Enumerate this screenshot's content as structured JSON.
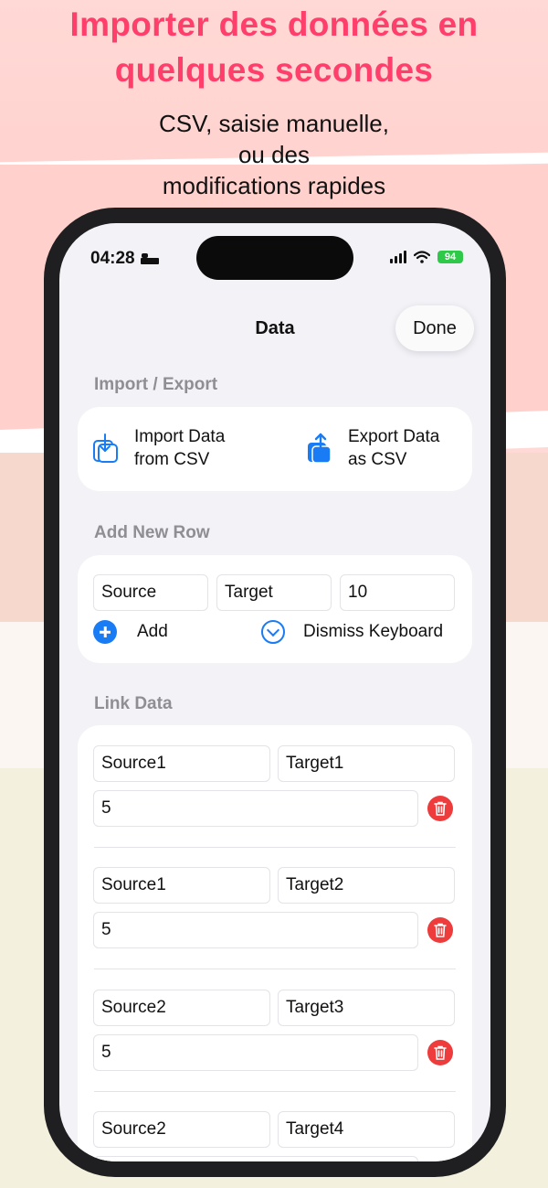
{
  "promo": {
    "headline_line1": "Importer des données en",
    "headline_line2": "quelques secondes",
    "sub_line1": "CSV, saisie manuelle,",
    "sub_line2": "ou des",
    "sub_line3": "modifications rapides"
  },
  "status_bar": {
    "time": "04:28",
    "battery": "94",
    "icons": [
      "bed-icon",
      "cellular-signal-icon",
      "wifi-icon",
      "battery-charging-icon"
    ]
  },
  "nav": {
    "title": "Data",
    "done_label": "Done"
  },
  "import_export": {
    "section_label": "Import / Export",
    "import_line1": "Import Data",
    "import_line2": "from CSV",
    "export_line1": "Export Data",
    "export_line2": "as CSV"
  },
  "add_row": {
    "section_label": "Add New Row",
    "source_value": "Source",
    "target_value": "Target",
    "value_value": "10",
    "add_label": "Add",
    "dismiss_label": "Dismiss Keyboard"
  },
  "link_data": {
    "section_label": "Link Data",
    "rows": [
      {
        "source": "Source1",
        "target": "Target1",
        "value": "5"
      },
      {
        "source": "Source1",
        "target": "Target2",
        "value": "5"
      },
      {
        "source": "Source2",
        "target": "Target3",
        "value": "5"
      },
      {
        "source": "Source2",
        "target": "Target4",
        "value": ""
      }
    ]
  },
  "colors": {
    "accent": "#1a7cf5",
    "headline": "#ff3f6b",
    "delete": "#ee3b3b"
  }
}
